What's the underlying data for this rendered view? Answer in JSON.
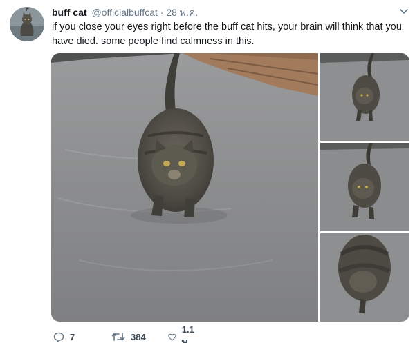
{
  "tweet": {
    "display_name": "buff cat",
    "handle": "@officialbuffcat",
    "separator": "·",
    "timestamp": "28 พ.ค.",
    "text": "if you close your eyes right before the buff cat hits, your brain will think that you have died. some people find calmness in this.",
    "avatar_icon": "cat-avatar",
    "menu_icon": "chevron-down-icon"
  },
  "media": {
    "main_alt": "cat-walking-toward-camera",
    "thumbnails": [
      "cat-walking-far",
      "cat-walking-closer",
      "cat-close-up-blur"
    ]
  },
  "actions": {
    "reply_count": "7",
    "retweet_count": "384",
    "like_count": "1.1 พ.",
    "reply_icon": "reply-icon",
    "retweet_icon": "retweet-icon",
    "like_icon": "heart-icon"
  },
  "colors": {
    "text_primary": "#14171a",
    "text_secondary": "#657786",
    "asphalt": "#8c8e90"
  }
}
